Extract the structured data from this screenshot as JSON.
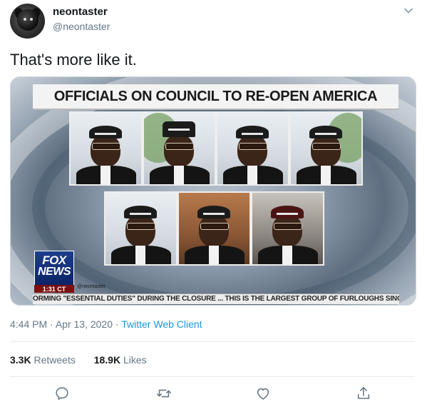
{
  "user": {
    "display_name": "neontaster",
    "handle": "@neontaster"
  },
  "tweet": {
    "text": "That's more like it.",
    "time": "4:44 PM",
    "separator": "·",
    "date": "Apr 13, 2020",
    "source": "Twitter Web Client"
  },
  "media": {
    "headline": "OFFICIALS ON COUNCIL TO RE-OPEN AMERICA",
    "logo_line1": "FOX",
    "logo_line2": "NEWS",
    "clock": "1:31 CT",
    "watermark": "@neontaster",
    "ticker": "ORMING \"ESSENTIAL DUTIES\" DURING THE CLOSURE ... THIS IS THE LARGEST GROUP OF FURLOUGHS SINC"
  },
  "stats": {
    "retweets_count": "3.3K",
    "retweets_label": "Retweets",
    "likes_count": "18.9K",
    "likes_label": "Likes"
  },
  "icons": {
    "caret": "chevron-down-icon",
    "reply": "reply-icon",
    "retweet": "retweet-icon",
    "like": "heart-icon",
    "share": "share-icon"
  },
  "colors": {
    "accent": "#1b95e0",
    "muted": "#657786",
    "text": "#14171a",
    "divider": "#e6ecf0"
  }
}
